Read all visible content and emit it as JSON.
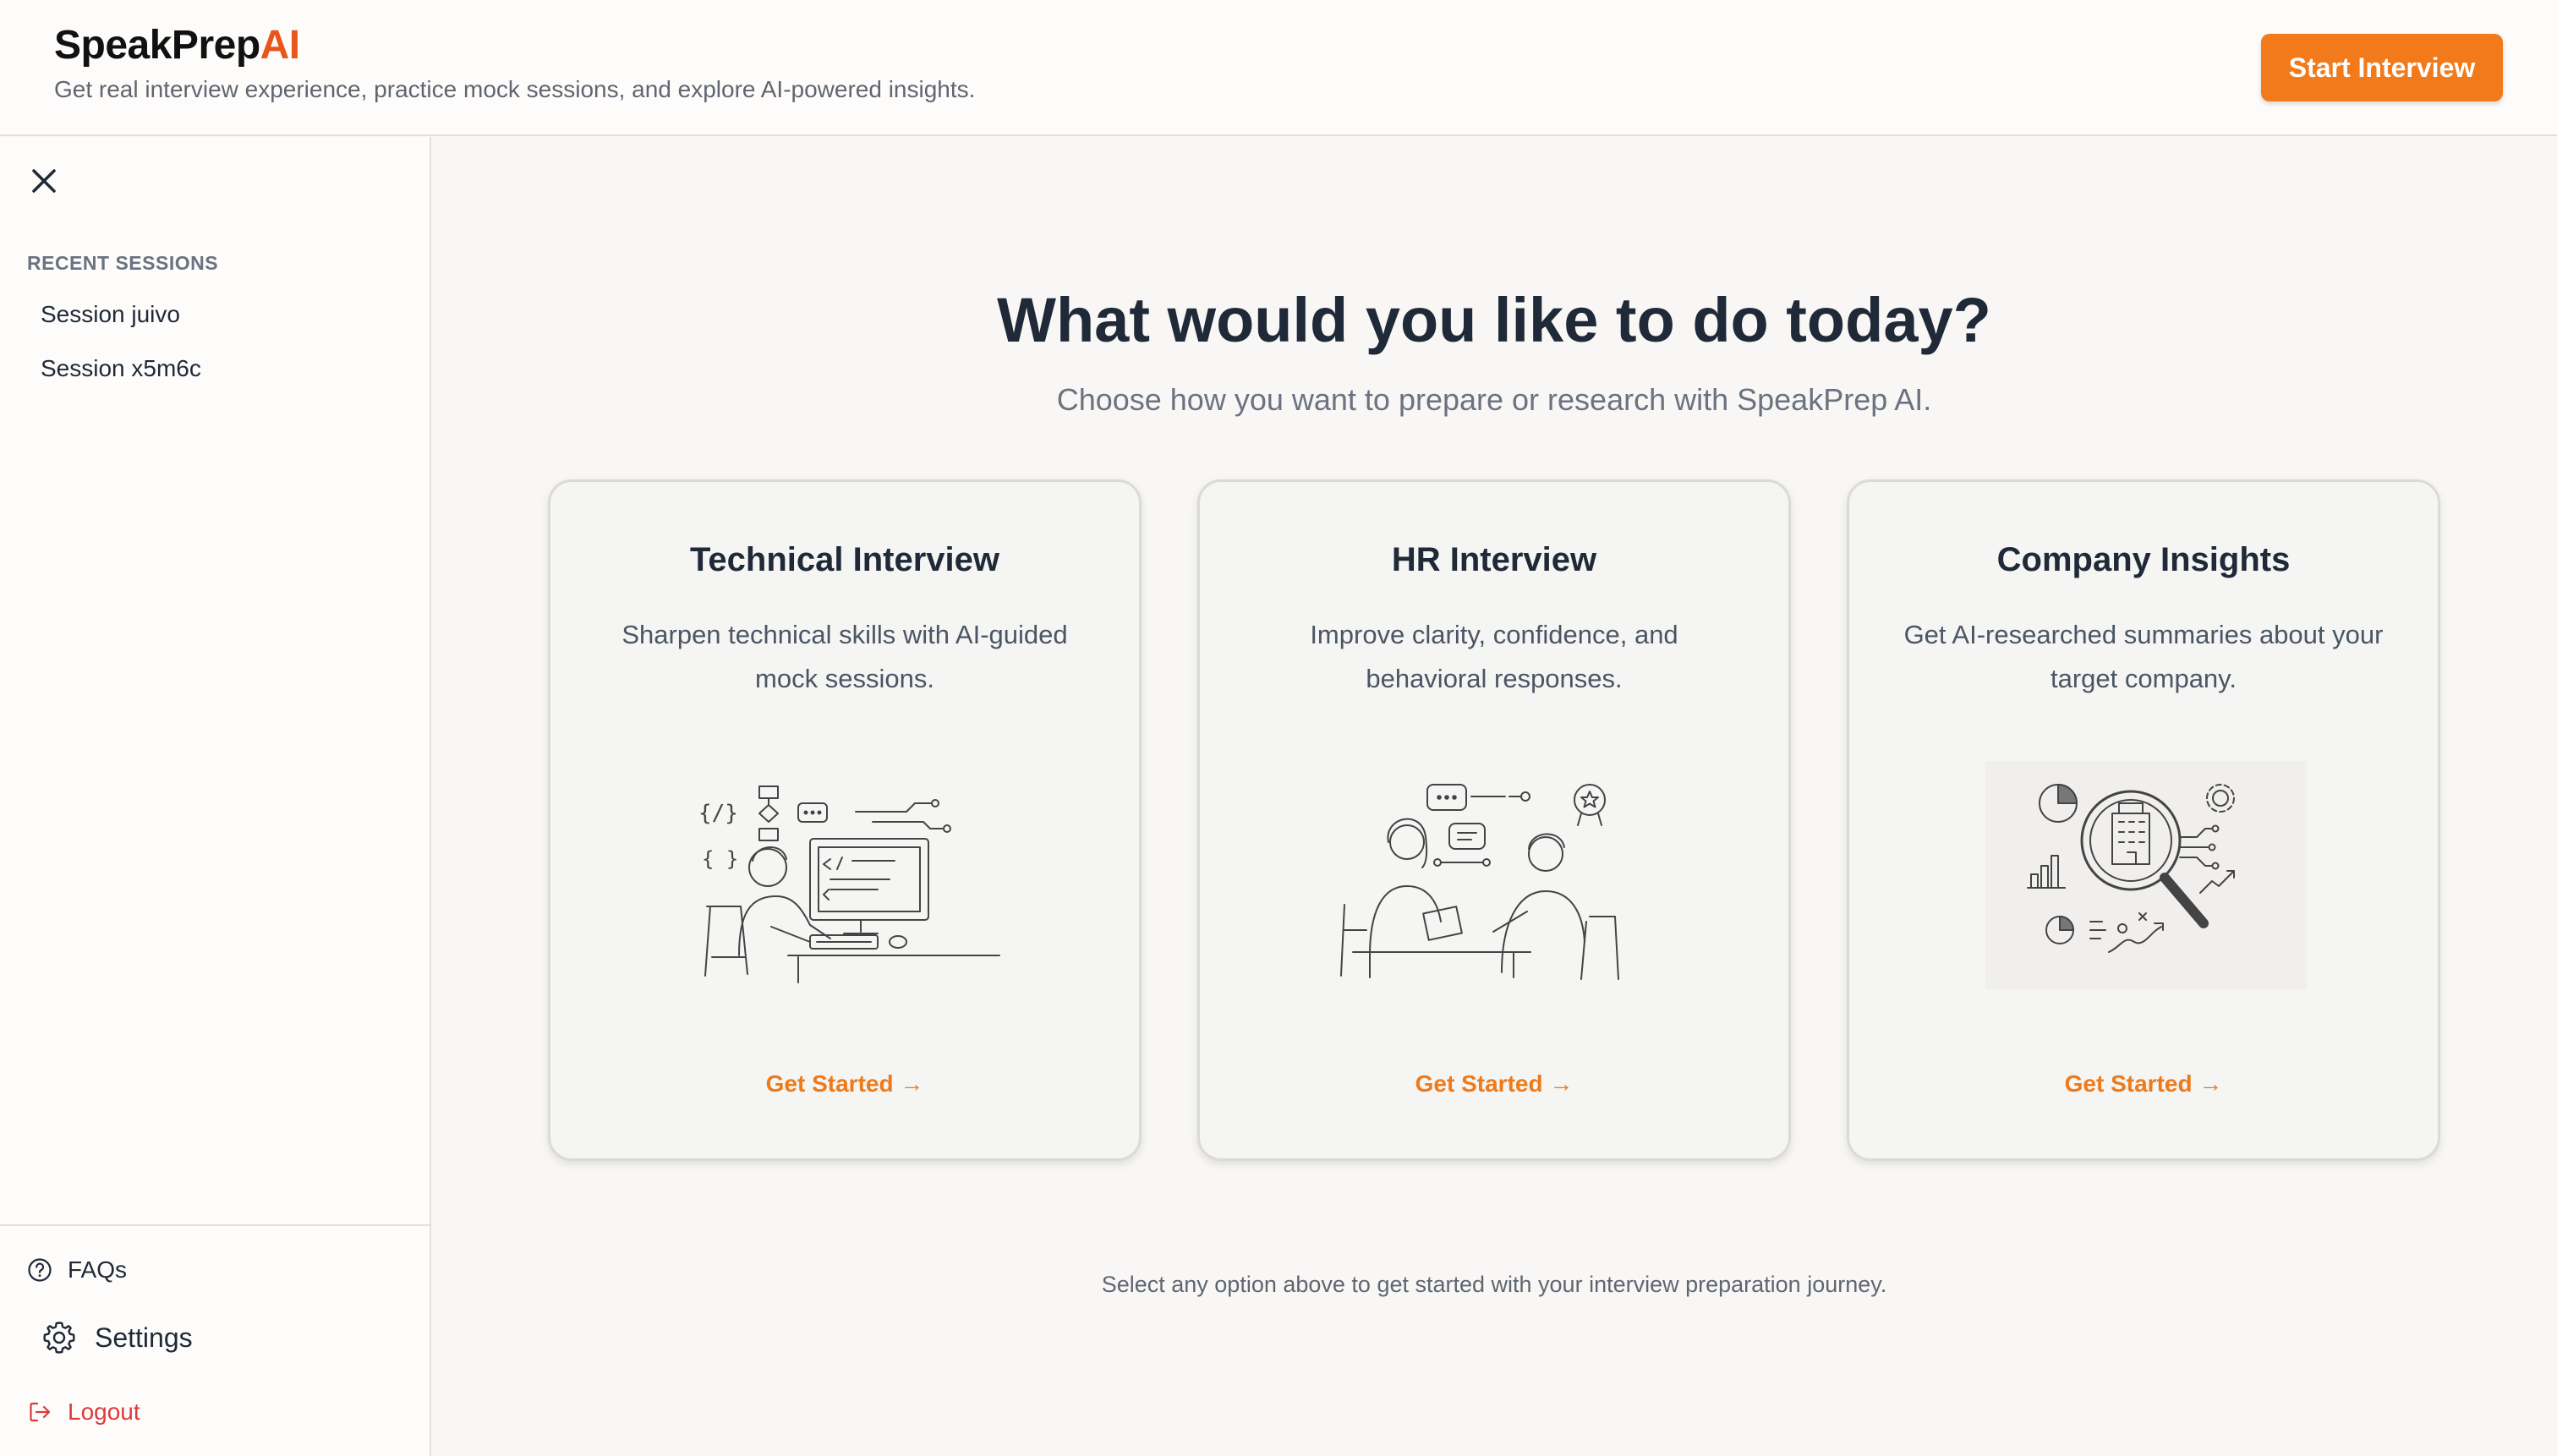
{
  "app": {
    "brand_main": "SpeakPrep",
    "brand_accent": "AI",
    "tagline": "Get real interview experience, practice mock sessions, and explore AI-powered insights.",
    "start_button": "Start Interview"
  },
  "sidebar": {
    "recent_heading": "RECENT SESSIONS",
    "sessions": [
      {
        "label": "Session juivo"
      },
      {
        "label": "Session x5m6c"
      }
    ],
    "faqs": "FAQs",
    "settings": "Settings",
    "logout": "Logout"
  },
  "main": {
    "title": "What would you like to do today?",
    "subtitle": "Choose how you want to prepare or research with SpeakPrep AI.",
    "cards": [
      {
        "title": "Technical Interview",
        "description": "Sharpen technical skills with AI-guided mock sessions.",
        "cta": "Get Started →",
        "illustration": "developer-at-computer-illustration"
      },
      {
        "title": "HR Interview",
        "description": "Improve clarity, confidence, and behavioral responses.",
        "cta": "Get Started →",
        "illustration": "two-people-conversation-illustration"
      },
      {
        "title": "Company Insights",
        "description": "Get AI-researched summaries about your target company.",
        "cta": "Get Started →",
        "illustration": "magnifier-building-analytics-illustration"
      }
    ],
    "footer_note": "Select any option above to get started with your interview preparation journey."
  },
  "colors": {
    "accent": "#f27a1a",
    "brand_ai": "#e8561c",
    "logout": "#dc3b3b",
    "background": "#f8f7f5"
  }
}
